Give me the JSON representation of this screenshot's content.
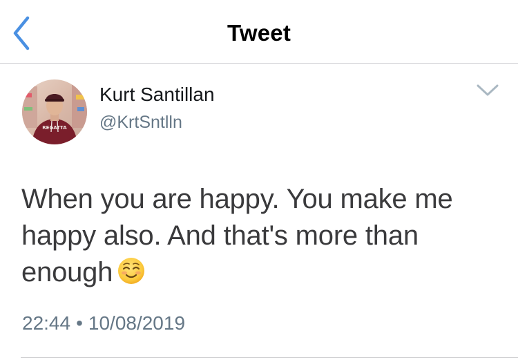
{
  "nav": {
    "title": "Tweet",
    "back_icon": "chevron-left-icon",
    "accent_color": "#4a90e2"
  },
  "tweet": {
    "author": {
      "display_name": "Kurt Santillan",
      "handle": "@KrtSntlln",
      "avatar_caption": "REGATTA"
    },
    "text": "When you are happy. You make me happy also. And that's more than enough",
    "emoji": "smiling-face-icon",
    "time": "22:44",
    "separator": "•",
    "date": "10/08/2019",
    "more_icon": "chevron-down-icon"
  }
}
